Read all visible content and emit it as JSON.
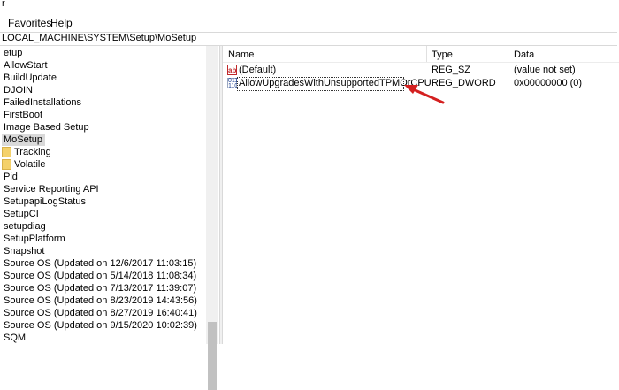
{
  "window": {
    "title_glyph": "r"
  },
  "menu": {
    "items": [
      "Favorites",
      "Help"
    ]
  },
  "address": {
    "path": "LOCAL_MACHINE\\SYSTEM\\Setup\\MoSetup"
  },
  "tree": {
    "items": [
      {
        "label": "etup",
        "indent": 0,
        "selected": false,
        "folder": false
      },
      {
        "label": "AllowStart",
        "indent": 0,
        "selected": false,
        "folder": false
      },
      {
        "label": "BuildUpdate",
        "indent": 0,
        "selected": false,
        "folder": false
      },
      {
        "label": "DJOIN",
        "indent": 0,
        "selected": false,
        "folder": false
      },
      {
        "label": "FailedInstallations",
        "indent": 0,
        "selected": false,
        "folder": false
      },
      {
        "label": "FirstBoot",
        "indent": 0,
        "selected": false,
        "folder": false
      },
      {
        "label": "Image Based Setup",
        "indent": 0,
        "selected": false,
        "folder": false
      },
      {
        "label": "MoSetup",
        "indent": 0,
        "selected": true,
        "folder": false
      },
      {
        "label": "Tracking",
        "indent": 1,
        "selected": false,
        "folder": true
      },
      {
        "label": "Volatile",
        "indent": 1,
        "selected": false,
        "folder": true
      },
      {
        "label": "Pid",
        "indent": 0,
        "selected": false,
        "folder": false
      },
      {
        "label": "Service Reporting API",
        "indent": 0,
        "selected": false,
        "folder": false
      },
      {
        "label": "SetupapiLogStatus",
        "indent": 0,
        "selected": false,
        "folder": false
      },
      {
        "label": "SetupCI",
        "indent": 0,
        "selected": false,
        "folder": false
      },
      {
        "label": "setupdiag",
        "indent": 0,
        "selected": false,
        "folder": false
      },
      {
        "label": "SetupPlatform",
        "indent": 0,
        "selected": false,
        "folder": false
      },
      {
        "label": "Snapshot",
        "indent": 0,
        "selected": false,
        "folder": false
      },
      {
        "label": "Source OS (Updated on 12/6/2017 11:03:15)",
        "indent": 0,
        "selected": false,
        "folder": false
      },
      {
        "label": "Source OS (Updated on 5/14/2018 11:08:34)",
        "indent": 0,
        "selected": false,
        "folder": false
      },
      {
        "label": "Source OS (Updated on 7/13/2017 11:39:07)",
        "indent": 0,
        "selected": false,
        "folder": false
      },
      {
        "label": "Source OS (Updated on 8/23/2019 14:43:56)",
        "indent": 0,
        "selected": false,
        "folder": false
      },
      {
        "label": "Source OS (Updated on 8/27/2019 16:40:41)",
        "indent": 0,
        "selected": false,
        "folder": false
      },
      {
        "label": "Source OS (Updated on 9/15/2020 10:02:39)",
        "indent": 0,
        "selected": false,
        "folder": false
      },
      {
        "label": "SQM",
        "indent": 0,
        "selected": false,
        "folder": false
      }
    ]
  },
  "list": {
    "columns": [
      "Name",
      "Type",
      "Data"
    ],
    "rows": [
      {
        "icon": "ab-string-icon",
        "icon_text": "ab",
        "name": "(Default)",
        "type": "REG_SZ",
        "data": "(value not set)",
        "selected": false
      },
      {
        "icon": "binary-dword-icon",
        "icon_text": "011 110",
        "name": "AllowUpgradesWithUnsupportedTPMOrCPU",
        "type": "REG_DWORD",
        "data": "0x00000000 (0)",
        "selected": true
      }
    ]
  },
  "annotation": {
    "arrow_color": "#d42020",
    "icon": "red-arrow-icon"
  },
  "colors": {
    "folder": "#f4d16b",
    "selection": "#d9d9d9"
  }
}
